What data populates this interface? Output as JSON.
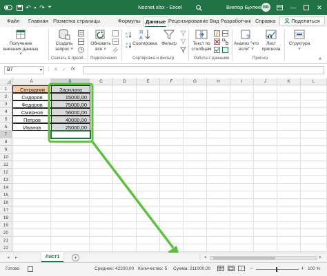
{
  "titlebar": {
    "autosave_icon": "autosave-icon",
    "title": "Noznet.xlsx - Excel",
    "user": "Виктор Бухтеев",
    "avatar_initials": "ВБ"
  },
  "tabs": [
    "Файл",
    "Главная",
    "Разметка страницы",
    "Формулы",
    "Данные",
    "Рецензирование",
    "Вид",
    "Разработчик",
    "Справка"
  ],
  "active_tab": "Данные",
  "share_label": "Поделиться",
  "ribbon": {
    "buttons": {
      "get_data_l1": "Получение",
      "get_data_l2": "внешних данных ˅",
      "create_query_l1": "Создать",
      "create_query_l2": "запрос ˅",
      "refresh_l1": "Обновить",
      "refresh_l2": "все ˅",
      "sort": "Сортировка",
      "filter": "Фильтр",
      "text_to_cols_l1": "Текст по",
      "text_to_cols_l2": "столбцам",
      "whatif_l1": "Анализ \"что",
      "whatif_l2": "если\" ˅",
      "forecast_l1": "Лист",
      "forecast_l2": "прогноза",
      "structure_l1": "Структура",
      "structure_l2": "˅"
    },
    "groups": {
      "get_transform": "Скачать & преоб...",
      "connections": "Подключения",
      "sort_filter": "Сортировка и фильтр",
      "data_tools": "Работа с данными",
      "forecast": "Прогноз"
    }
  },
  "formula_bar": {
    "name_box": "B7",
    "fx": "fx",
    "value": ""
  },
  "grid": {
    "columns": [
      "A",
      "B",
      "C",
      "D",
      "E",
      "F",
      "G",
      "H",
      "I",
      "J",
      "K",
      "L"
    ],
    "rows": [
      "1",
      "2",
      "3",
      "4",
      "5",
      "6",
      "7",
      "8",
      "9",
      "10",
      "11",
      "12",
      "13",
      "14",
      "15",
      "16",
      "17",
      "18",
      "19",
      "20",
      "21",
      "22"
    ],
    "header_a": "Сотрудник",
    "header_b": "Зарплата",
    "names": [
      "Сидоров",
      "Федоров",
      "Смирнов",
      "Петров",
      "Иванов"
    ],
    "salaries": [
      "15000,00",
      "75000,00",
      "56000,00",
      "40000,00",
      "25000,00"
    ]
  },
  "sheet": {
    "tab": "Лист1",
    "add_icon": "plus-icon"
  },
  "status": {
    "ready": "Готово",
    "average": "Среднее: 42200,00",
    "count": "Количество: 5",
    "sum": "Сумма: 211000,00",
    "zoom": "100 %"
  },
  "colors": {
    "excel_green": "#217346",
    "annotation_green": "#5cc13a",
    "header_fill": "#f8cba6",
    "selected_fill": "#d9d9d9"
  }
}
